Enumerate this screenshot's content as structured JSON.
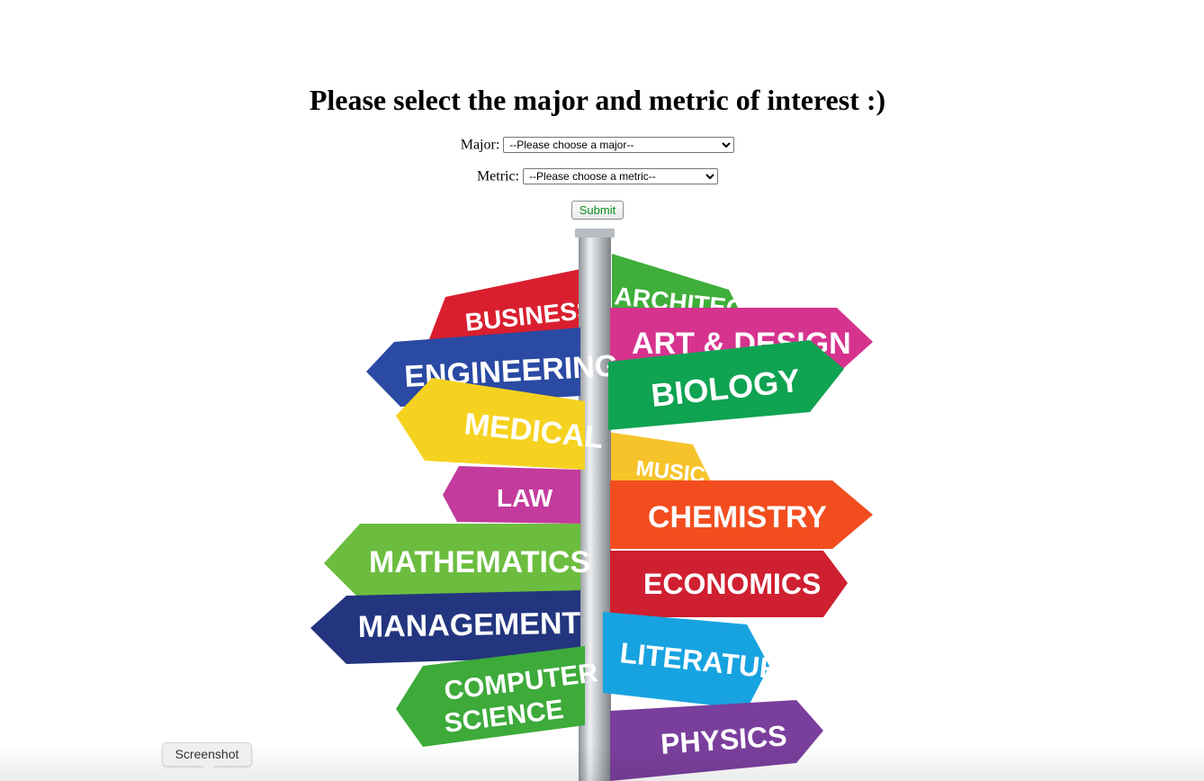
{
  "heading": "Please select the major and metric of interest :)",
  "form": {
    "major_label": "Major:",
    "major_selected": "--Please choose a major--",
    "metric_label": "Metric:",
    "metric_selected": "--Please choose a metric--",
    "submit_label": "Submit",
    "submit_color": "#0a8a1a"
  },
  "signpost": {
    "signs": [
      {
        "text": "ARCHITECTURE",
        "color": "#3fae3a",
        "icon": "signpost-sign"
      },
      {
        "text": "BUSINESS",
        "color": "#d91f2f"
      },
      {
        "text": "ART & DESIGN",
        "color": "#d6338f"
      },
      {
        "text": "ENGINEERING",
        "color": "#2a4aa3"
      },
      {
        "text": "BIOLOGY",
        "color": "#10a352"
      },
      {
        "text": "MEDICAL",
        "color": "#f5d21f"
      },
      {
        "text": "MUSIC",
        "color": "#f6c32a"
      },
      {
        "text": "LAW",
        "color": "#c23b9d"
      },
      {
        "text": "CHEMISTRY",
        "color": "#f24d1f"
      },
      {
        "text": "MATHEMATICS",
        "color": "#6cbd3f"
      },
      {
        "text": "ECONOMICS",
        "color": "#cf2031"
      },
      {
        "text": "MANAGEMENT",
        "color": "#23357f"
      },
      {
        "text": "LITERATURE",
        "color": "#17a3e0"
      },
      {
        "text": "COMPUTER",
        "color": "#3daa3a"
      },
      {
        "text": "SCIENCE",
        "color": "#3daa3a"
      },
      {
        "text": "PHYSICS",
        "color": "#7a3f9c"
      }
    ]
  },
  "tooltip": "Screenshot"
}
